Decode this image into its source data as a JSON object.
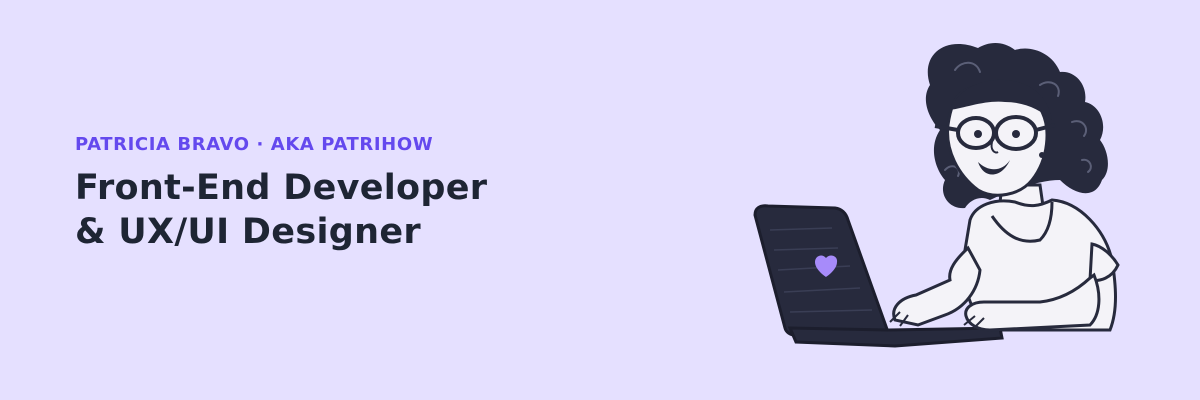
{
  "banner": {
    "eyebrow": "PATRICIA BRAVO · AKA PATRIHOW",
    "headline_line1": "Front-End Developer",
    "headline_line2": "& UX/UI Designer",
    "colors": {
      "background": "#e5e0ff",
      "accent": "#6449ee",
      "heading": "#1e2534",
      "ink": "#272a3d",
      "paper": "#f4f3f8",
      "heart": "#a78bfa"
    },
    "illustration": {
      "subject": "woman-with-glasses-using-laptop",
      "icon": "heart-icon"
    }
  }
}
